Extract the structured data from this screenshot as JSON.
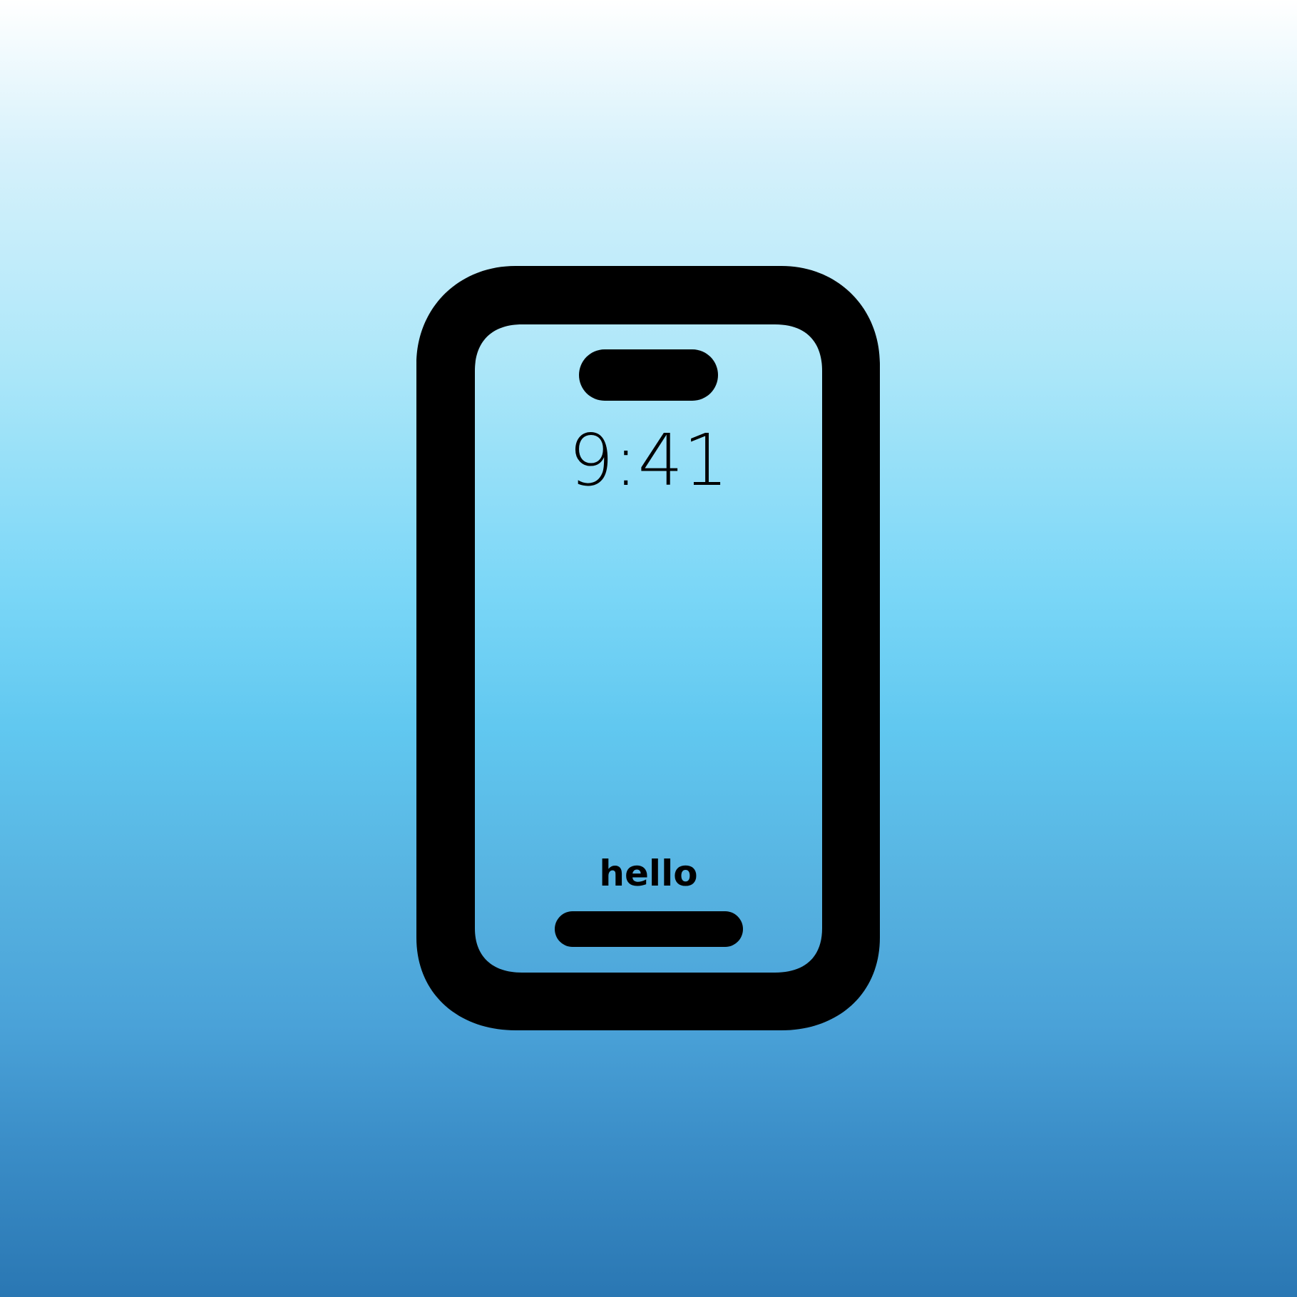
{
  "background": {
    "top_color": "#ffffff",
    "middle_color": "#61c8f0",
    "bottom_color": "#2a77b3"
  },
  "device": {
    "icon": "smartphone-icon",
    "outline_color": "#000000",
    "time_text": "9:41",
    "greeting_text": "hello",
    "dynamic_island_icon": "dynamic-island-icon",
    "home_indicator_icon": "home-indicator-icon"
  }
}
